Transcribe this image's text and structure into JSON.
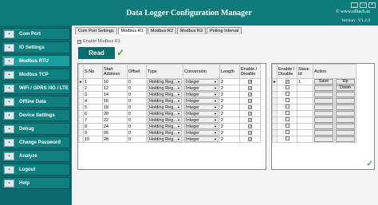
{
  "app": {
    "title": "Data Logger Configuration Manager",
    "website": "© www.rdltech.in",
    "version": "Version : V1.2.9"
  },
  "window_controls": [
    "_",
    "□",
    "×"
  ],
  "sidebar": {
    "items": [
      {
        "label": "Com Port",
        "icon": "com-port-icon"
      },
      {
        "label": "IO Settings",
        "icon": "io-icon"
      },
      {
        "label": "Modbus RTU",
        "icon": "modbus-icon"
      },
      {
        "label": "Modbus TCP",
        "icon": "modbus-tcp-icon"
      },
      {
        "label": "WiFi / GPRS /4G / LTE",
        "icon": "wifi-icon"
      },
      {
        "label": "Offline Data",
        "icon": "offline-data-icon"
      },
      {
        "label": "Device Settings",
        "icon": "device-settings-icon"
      },
      {
        "label": "Debug",
        "icon": "debug-icon"
      },
      {
        "label": "Change Password",
        "icon": "password-icon"
      },
      {
        "label": "Analyze",
        "icon": "analyze-icon"
      },
      {
        "label": "Logout",
        "icon": "logout-icon"
      },
      {
        "label": "Help",
        "icon": "help-icon"
      }
    ],
    "active_index": 2
  },
  "tabs": [
    "Com Port Settings",
    "Modbus R1",
    "Modbus R2",
    "Modbus R3",
    "Polling Interval"
  ],
  "selected_tab": 1,
  "enable_label": "Enable Modbus R1",
  "read_button": "Read",
  "grid1": {
    "headers": [
      "S.No",
      "Start Address",
      "Offset",
      "Type",
      "Conversion",
      "Length",
      "Enable / Disable"
    ],
    "rows": [
      {
        "sno": "1",
        "addr": "10",
        "offset": "0",
        "type": "Holding Reg...",
        "conv": "Integer",
        "len": "2",
        "en": "✓"
      },
      {
        "sno": "2",
        "addr": "12",
        "offset": "0",
        "type": "Holding Reg...",
        "conv": "Integer",
        "len": "2",
        "en": "✓"
      },
      {
        "sno": "3",
        "addr": "14",
        "offset": "0",
        "type": "Holding Reg...",
        "conv": "Integer",
        "len": "2",
        "en": "✓"
      },
      {
        "sno": "4",
        "addr": "16",
        "offset": "0",
        "type": "Holding Reg...",
        "conv": "Integer",
        "len": "2",
        "en": "✓"
      },
      {
        "sno": "5",
        "addr": "18",
        "offset": "0",
        "type": "Holding Reg...",
        "conv": "Integer",
        "len": "2",
        "en": "✓"
      },
      {
        "sno": "6",
        "addr": "20",
        "offset": "0",
        "type": "Holding Reg...",
        "conv": "Integer",
        "len": "2",
        "en": "✓"
      },
      {
        "sno": "7",
        "addr": "22",
        "offset": "0",
        "type": "Holding Reg...",
        "conv": "Integer",
        "len": "2",
        "en": "✓"
      },
      {
        "sno": "8",
        "addr": "24",
        "offset": "0",
        "type": "Holding Reg...",
        "conv": "Integer",
        "len": "2",
        "en": "✓"
      },
      {
        "sno": "9",
        "addr": "26",
        "offset": "0",
        "type": "Holding Reg...",
        "conv": "Integer",
        "len": "2",
        "en": "✓"
      },
      {
        "sno": "10",
        "addr": "28",
        "offset": "0",
        "type": "Holding Reg...",
        "conv": "Integer",
        "len": "2",
        "en": "✓"
      }
    ]
  },
  "grid2": {
    "headers": [
      "Enable / Disable",
      "Slave Id",
      "Action"
    ],
    "rows": [
      {
        "en": "✓",
        "slave": "1",
        "save": "Save",
        "move": "Up"
      },
      {
        "en": "",
        "slave": "",
        "save": "",
        "move": "Down"
      },
      {
        "en": "",
        "slave": "",
        "save": "",
        "move": ""
      },
      {
        "en": "",
        "slave": "",
        "save": "",
        "move": ""
      },
      {
        "en": "",
        "slave": "",
        "save": "",
        "move": ""
      },
      {
        "en": "",
        "slave": "",
        "save": "",
        "move": ""
      },
      {
        "en": "",
        "slave": "",
        "save": "",
        "move": ""
      },
      {
        "en": "",
        "slave": "",
        "save": "",
        "move": ""
      },
      {
        "en": "",
        "slave": "",
        "save": "",
        "move": ""
      },
      {
        "en": "",
        "slave": "",
        "save": "",
        "move": ""
      }
    ]
  },
  "status_check_icon": "check-icon"
}
